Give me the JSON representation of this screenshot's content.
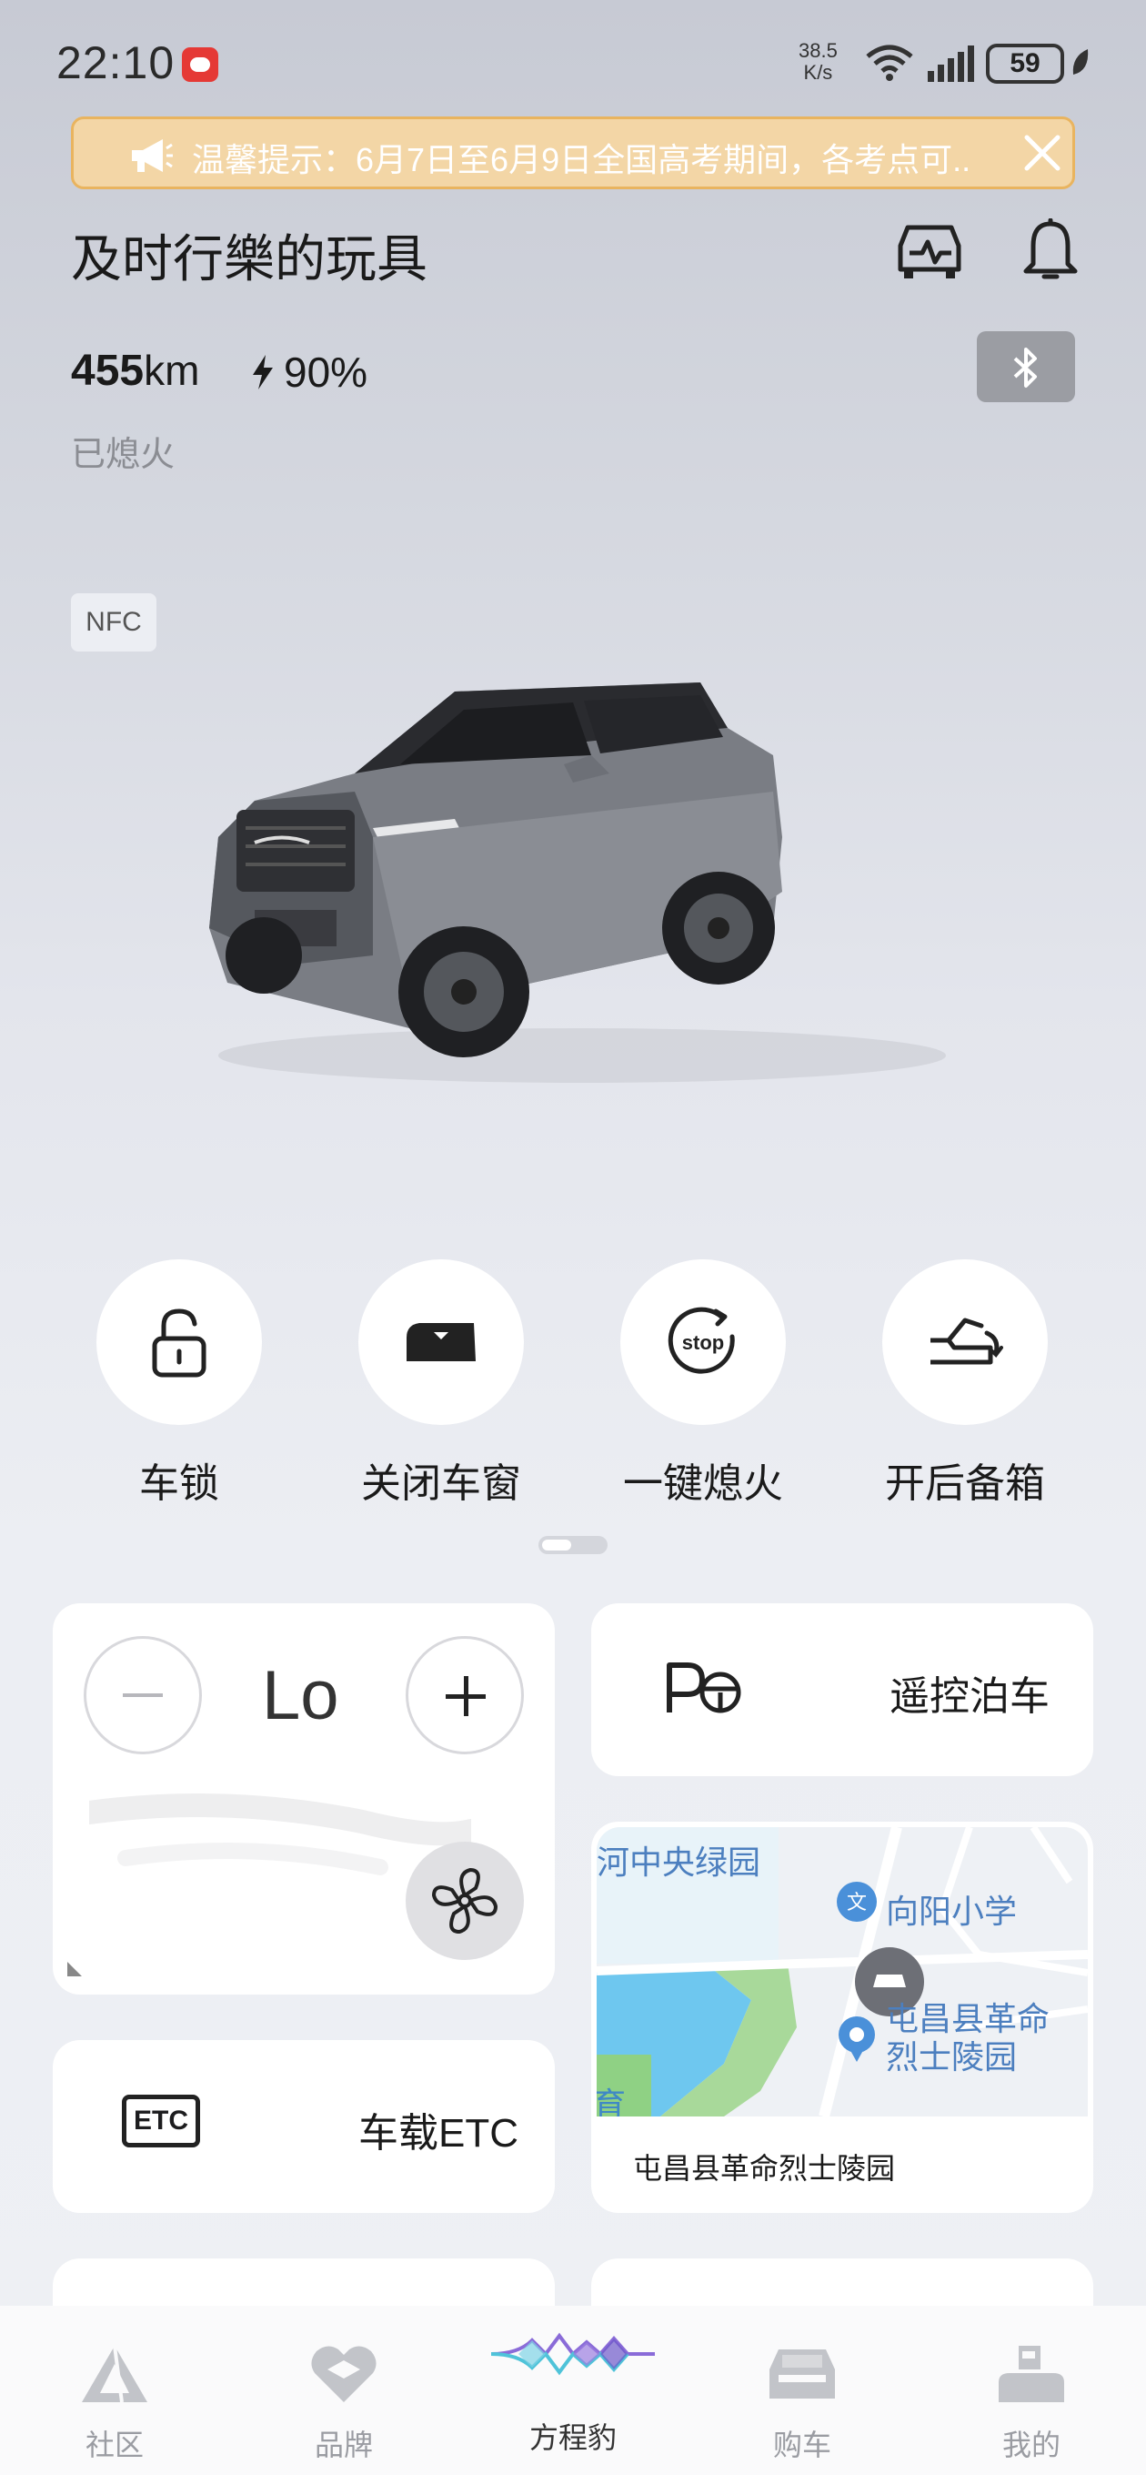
{
  "status_bar": {
    "time": "22:10",
    "net_speed_value": "38.5",
    "net_speed_unit": "K/s",
    "battery": "59"
  },
  "banner": {
    "text": "温馨提示：6月7日至6月9日全国高考期间，各考点可.."
  },
  "header": {
    "car_name": "及时行樂的玩具",
    "range_value": "455",
    "range_unit": "km",
    "charge": "90%",
    "engine_status": "已熄火",
    "nfc": "NFC"
  },
  "quick_controls": [
    {
      "label": "车锁",
      "icon": "lock-icon"
    },
    {
      "label": "关闭车窗",
      "icon": "window-icon"
    },
    {
      "label": "一键熄火",
      "icon": "stop-icon"
    },
    {
      "label": "开后备箱",
      "icon": "trunk-icon"
    }
  ],
  "climate": {
    "temperature": "Lo"
  },
  "parking": {
    "label": "遥控泊车"
  },
  "etc": {
    "icon_text": "ETC",
    "label": "车载ETC"
  },
  "map": {
    "poi_1": "河中央绿园",
    "poi_2": "向阳小学",
    "poi_3_line1": "屯昌县革命",
    "poi_3_line2": "烈士陵园",
    "poi_4": "育",
    "caption": "屯昌县革命烈士陵园"
  },
  "bottom_nav": [
    {
      "label": "社区",
      "icon": "community-icon",
      "active": false
    },
    {
      "label": "品牌",
      "icon": "brand-icon",
      "active": false
    },
    {
      "label": "方程豹",
      "icon": "fangchengbao-logo",
      "active": true
    },
    {
      "label": "购车",
      "icon": "car-purchase-icon",
      "active": false
    },
    {
      "label": "我的",
      "icon": "profile-icon",
      "active": false
    }
  ],
  "colors": {
    "banner_bg": "#f3d6a6",
    "banner_border": "#e9b45f",
    "map_text": "#4c7fbf"
  }
}
